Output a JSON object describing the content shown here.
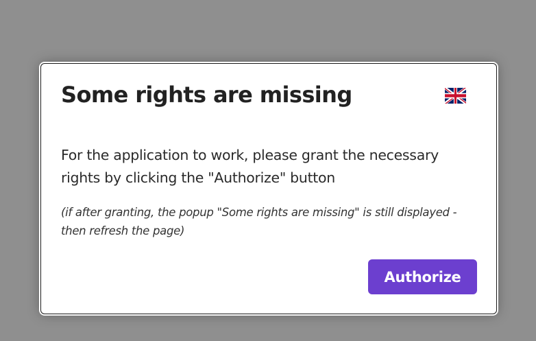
{
  "dialog": {
    "title": "Some rights are missing",
    "message": "For the application to work, please grant the necessary rights by clicking the \"Authorize\" button",
    "note": "(if after granting, the popup \"Some rights are missing\" is still displayed - then refresh the page)",
    "authorize_label": "Authorize",
    "language_icon": "uk-flag-icon"
  },
  "colors": {
    "backdrop": "#8f8f8f",
    "dialog_background": "#ffffff",
    "button_accent": "#6c3fcf",
    "flag_blue": "#012169",
    "flag_red": "#c8102e"
  }
}
